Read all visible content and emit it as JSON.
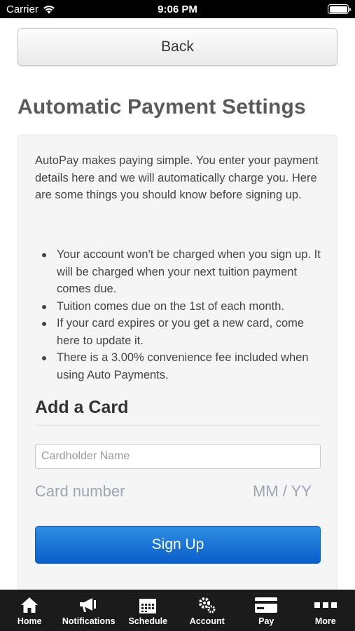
{
  "status_bar": {
    "carrier": "Carrier",
    "time": "9:06 PM"
  },
  "header": {
    "back_label": "Back",
    "title": "Automatic Payment Settings"
  },
  "panel": {
    "intro": "AutoPay makes paying simple. You enter your payment details here and we will automatically charge you. Here are some things you should know before signing up.",
    "notes": [
      "Your account won't be charged when you sign up. It will be charged when your next tuition payment comes due.",
      "Tuition comes due on the 1st of each month.",
      "If your card expires or you get a new card, come here to update it.",
      "There is a 3.00% convenience fee included when using Auto Payments."
    ],
    "add_card_title": "Add a Card",
    "cardholder": {
      "placeholder": "Cardholder Name",
      "value": ""
    },
    "card_number_placeholder": "Card number",
    "expiry_placeholder": "MM / YY",
    "signup_label": "Sign Up"
  },
  "tab_bar": {
    "items": [
      {
        "label": "Home",
        "icon": "home-icon"
      },
      {
        "label": "Notifications",
        "icon": "megaphone-icon"
      },
      {
        "label": "Schedule",
        "icon": "calendar-icon"
      },
      {
        "label": "Account",
        "icon": "gears-icon"
      },
      {
        "label": "Pay",
        "icon": "credit-card-icon"
      },
      {
        "label": "More",
        "icon": "more-icon"
      }
    ]
  },
  "colors": {
    "primary_button": "#0a5ec9",
    "tab_bar": "#1b1b1b",
    "placeholder_text": "#9aa6b4"
  }
}
